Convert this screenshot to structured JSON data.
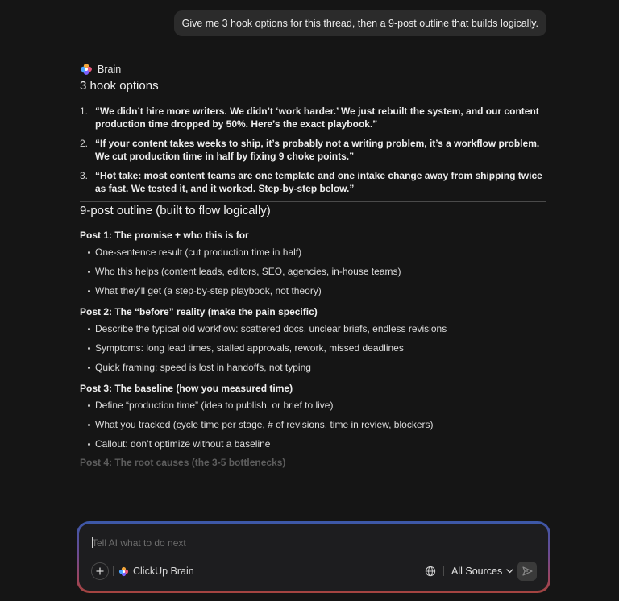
{
  "user_message": "Give me 3 hook options for this thread, then a 9-post outline that builds logically.",
  "assistant": {
    "name": "Brain",
    "hooks_title": "3 hook options",
    "hooks": [
      {
        "num": "1.",
        "text": "“We didn’t hire more writers. We didn’t ‘work harder.’ We just rebuilt the system, and our content production time dropped by 50%. Here’s the exact playbook.”"
      },
      {
        "num": "2.",
        "text": "“If your content takes weeks to ship, it’s probably not a writing problem, it’s a workflow problem. We cut production time in half by fixing 9 choke points.”"
      },
      {
        "num": "3.",
        "text": "“Hot take: most content teams are one template and one intake change away from shipping twice as fast. We tested it, and it worked. Step-by-step below.”"
      }
    ],
    "outline_title": "9-post outline (built to flow logically)",
    "posts": [
      {
        "title": "Post 1: The promise + who this is for",
        "bullets": [
          "One-sentence result (cut production time in half)",
          "Who this helps (content leads, editors, SEO, agencies, in-house teams)",
          "What they’ll get (a step-by-step playbook, not theory)"
        ]
      },
      {
        "title": "Post 2: The “before” reality (make the pain specific)",
        "bullets": [
          "Describe the typical old workflow: scattered docs, unclear briefs, endless revisions",
          "Symptoms: long lead times, stalled approvals, rework, missed deadlines",
          "Quick framing: speed is lost in handoffs, not typing"
        ]
      },
      {
        "title": "Post 3: The baseline (how you measured time)",
        "bullets": [
          "Define “production time” (idea to publish, or brief to live)",
          "What you tracked (cycle time per stage, # of revisions, time in review, blockers)",
          "Callout: don’t optimize without a baseline"
        ]
      }
    ],
    "partial_post_title": "Post 4: The root causes (the 3-5 bottlenecks)"
  },
  "composer": {
    "placeholder": "Tell AI what to do next",
    "brain_label": "ClickUp Brain",
    "sources_label": "All Sources"
  },
  "icons": {
    "brain": "brain-flower-logo",
    "plus": "plus-icon",
    "globe": "globe-icon",
    "chevron": "chevron-down-icon",
    "send": "send-arrow-icon"
  },
  "colors": {
    "background": "#151515",
    "bubble": "#2b2b2b",
    "composer_gradient": [
      "#3b58a8",
      "#6b4b92",
      "#9c4560",
      "#a4443f"
    ]
  }
}
